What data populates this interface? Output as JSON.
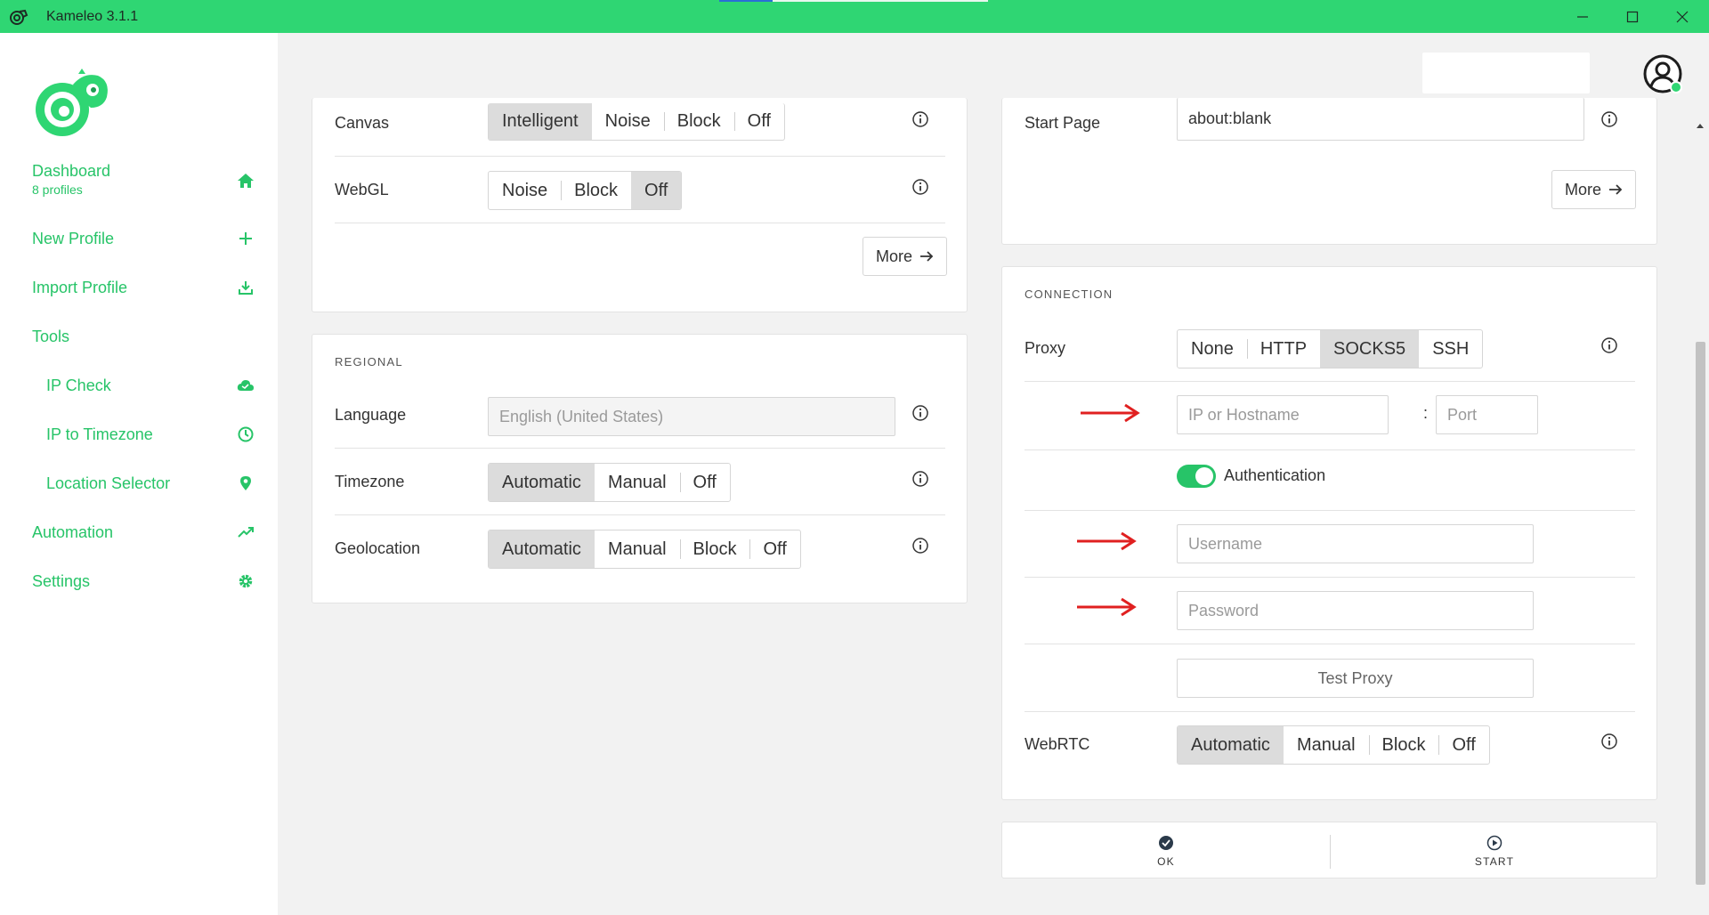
{
  "window": {
    "title": "Kameleo 3.1.1"
  },
  "sidebar": {
    "dashboard": {
      "label": "Dashboard",
      "sub": "8 profiles"
    },
    "items": [
      {
        "label": "New Profile",
        "icon": "plus-icon"
      },
      {
        "label": "Import Profile",
        "icon": "download-icon"
      },
      {
        "label": "Tools",
        "icon": ""
      },
      {
        "label": "IP Check",
        "icon": "cloud-check-icon"
      },
      {
        "label": "IP to Timezone",
        "icon": "clock-icon"
      },
      {
        "label": "Location Selector",
        "icon": "location-pin-icon"
      },
      {
        "label": "Automation",
        "icon": "trending-up-icon"
      },
      {
        "label": "Settings",
        "icon": "gear-icon"
      }
    ]
  },
  "fingerprint": {
    "canvas": {
      "label": "Canvas",
      "options": [
        "Intelligent",
        "Noise",
        "Block",
        "Off"
      ],
      "selected": "Intelligent"
    },
    "webgl": {
      "label": "WebGL",
      "options": [
        "Noise",
        "Block",
        "Off"
      ],
      "selected": "Off"
    },
    "more_label": "More"
  },
  "regional": {
    "title": "REGIONAL",
    "language": {
      "label": "Language",
      "placeholder": "English (United States)"
    },
    "timezone": {
      "label": "Timezone",
      "options": [
        "Automatic",
        "Manual",
        "Off"
      ],
      "selected": "Automatic"
    },
    "geolocation": {
      "label": "Geolocation",
      "options": [
        "Automatic",
        "Manual",
        "Block",
        "Off"
      ],
      "selected": "Automatic"
    }
  },
  "browser": {
    "start_page": {
      "label": "Start Page",
      "value": "about:blank"
    },
    "more_label": "More"
  },
  "connection": {
    "title": "CONNECTION",
    "proxy": {
      "label": "Proxy",
      "options": [
        "None",
        "HTTP",
        "SOCKS5",
        "SSH"
      ],
      "selected": "SOCKS5"
    },
    "host_placeholder": "IP or Hostname",
    "port_placeholder": "Port",
    "colon": ":",
    "authentication": {
      "label": "Authentication",
      "enabled": true
    },
    "username_placeholder": "Username",
    "password_placeholder": "Password",
    "test_proxy_label": "Test Proxy",
    "webrtc": {
      "label": "WebRTC",
      "options": [
        "Automatic",
        "Manual",
        "Block",
        "Off"
      ],
      "selected": "Automatic"
    }
  },
  "actions": {
    "ok_label": "OK",
    "start_label": "START"
  },
  "colors": {
    "brand": "#2fd673",
    "accent": "#27c468",
    "arrow": "#e02020"
  }
}
